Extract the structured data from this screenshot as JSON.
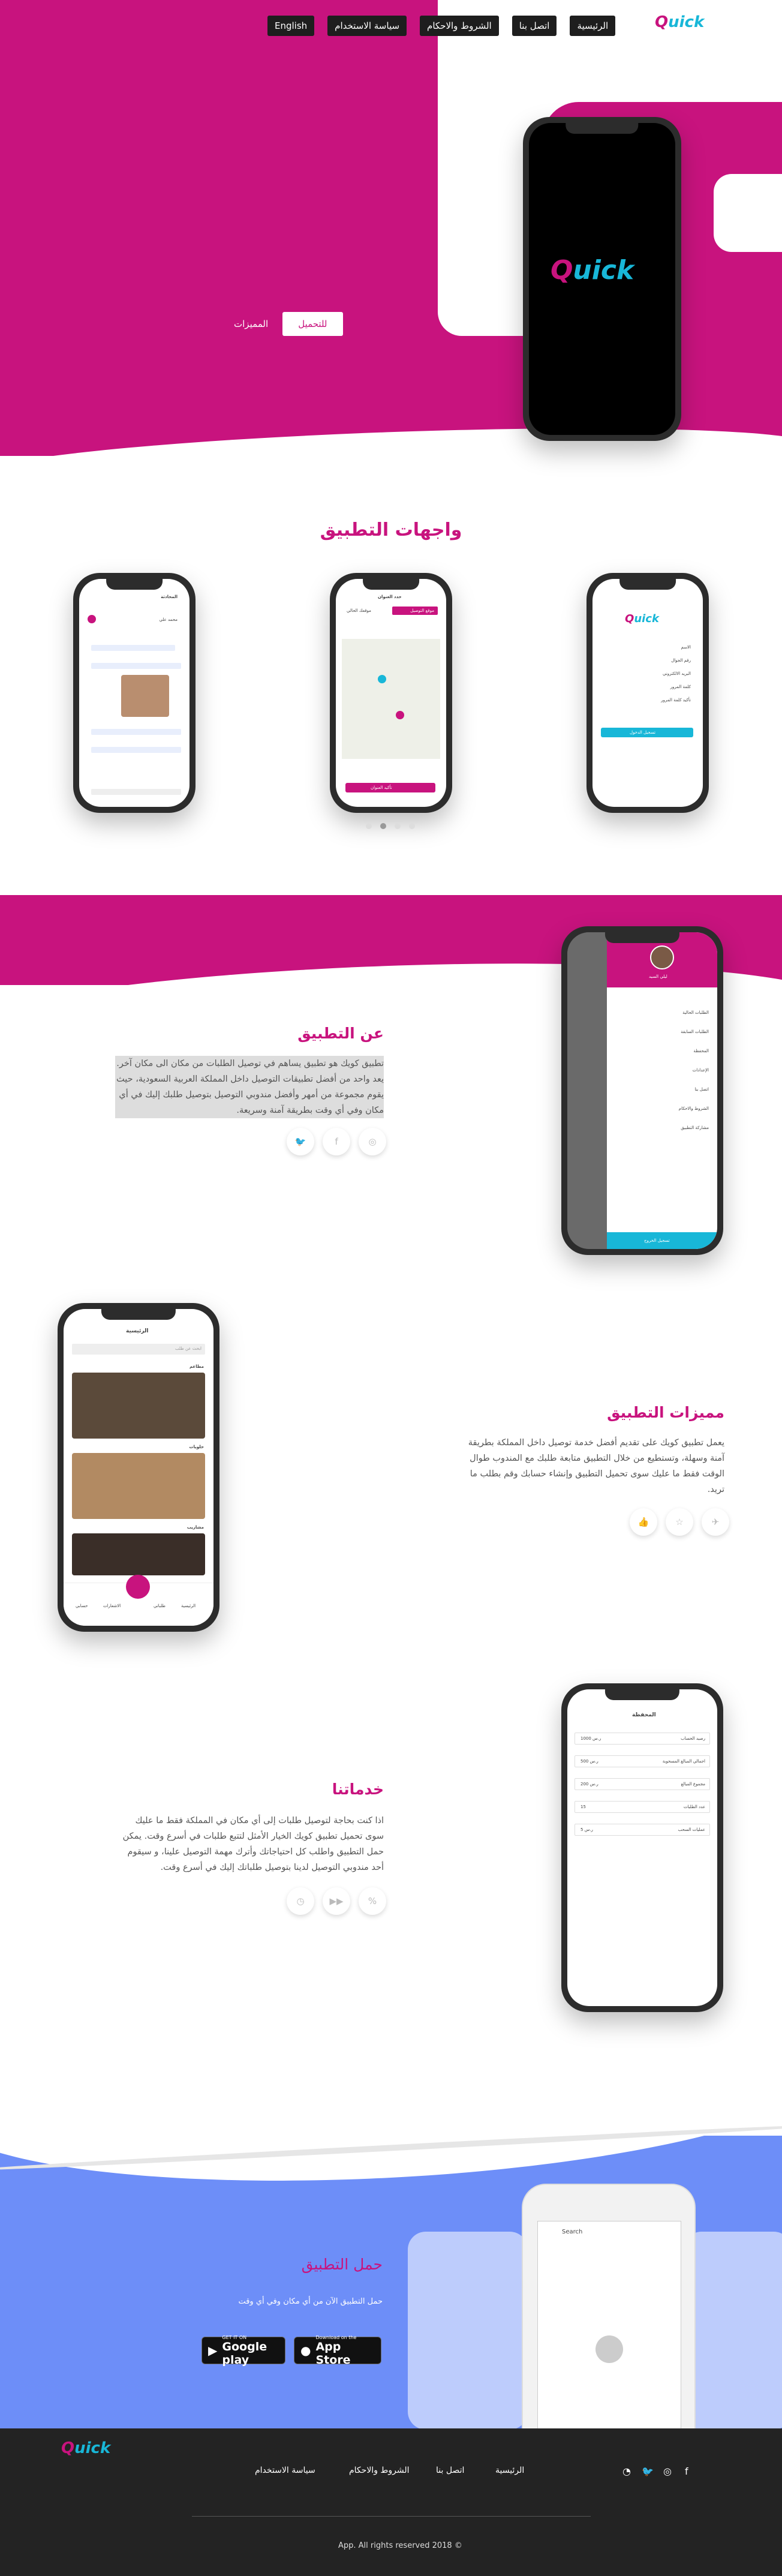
{
  "brand": {
    "logo_q": "Q",
    "logo_rest": "uick",
    "accent": "#c8137e",
    "secondary": "#18b7d8",
    "blue": "#6d8ef8"
  },
  "nav": {
    "english": "English",
    "privacy": "سياسة الاستخدام",
    "terms": "الشروط والاحكام",
    "contact": "اتصل بنا",
    "home": "الرئيسية"
  },
  "hero": {
    "download": "للتحميل",
    "features": "المميزات"
  },
  "screens_section": {
    "title": "واجهات التطبيق",
    "dots": 4,
    "active_dot": 2
  },
  "about": {
    "title": "عن التطبيق",
    "text": "تطبيق كويك هو تطبيق يساهم في توصيل الطلبات من مكان الى مكان آخر. يعد واحد من أفضل تطبيقات التوصيل داخل المملكة العربية السعودية، حيث يقوم مجموعة من أمهر وأفضل مندوبي التوصيل بتوصيل طلبك إليك في أي مكان وفي أي وقت بطريقة آمنة وسريعة.",
    "icons": [
      "twitter-icon",
      "facebook-icon",
      "instagram-icon"
    ]
  },
  "features": {
    "title": "مميزات التطبيق",
    "text": "يعمل تطبيق كويك على تقديم أفضل خدمة توصيل داخل المملكة بطريقة آمنة وسهلة، وتستطيع من خلال التطبيق متابعة طلبك مع المندوب طوال الوقت فقط ما عليك سوى تحميل التطبيق وإنشاء حسابك وقم بطلب ما تريد."
  },
  "services": {
    "title": "خدماتنا",
    "text": "اذا كنت بحاجة لتوصيل طلبات إلى أي مكان في المملكة فقط ما عليك سوى تحميل تطبيق كويك الخيار الأمثل لتتبع طلبات في أسرع وقت. يمكن حمل التطبيق واطلب كل احتياجاتك وأترك مهمة التوصيل علينا، و سيقوم أحد مندوبي التوصيل لدينا بتوصيل طلباتك إليك في أسرع وقت."
  },
  "download": {
    "title": "حمل التطبيق",
    "subtitle": "حمل التطبيق الآن من أي مكان وفي أي وقت",
    "google_small": "GET IT ON",
    "google_big": "Google play",
    "apple_small": "Download on the",
    "apple_big": "App Store",
    "search_placeholder": "Search"
  },
  "footer": {
    "home": "الرئيسية",
    "contact": "اتصل بنا",
    "terms": "الشروط والاحكام",
    "privacy": "سياسة الاستخدام",
    "copyright": "App. All rights reserved 2018 ©"
  },
  "phone_menu": {
    "user": "ليلي السيد",
    "items": [
      "الطلبات الحالية",
      "الطلبات السابقة",
      "المحفظة",
      "الإعدادات",
      "اتصل بنا",
      "الشروط والاحكام",
      "مشاركة التطبيق"
    ],
    "cta": "تسجيل الخروج"
  },
  "phone_home": {
    "title": "الرئيسية",
    "search": "ابحث عن طلب",
    "sec1": "مطاعم",
    "sec2": "حلويات",
    "sec3": "مشاريب",
    "tabs": [
      "الرئيسية",
      "طلباتي",
      "الاشعارات",
      "حسابي"
    ]
  },
  "phone_wallet": {
    "title": "المحفظة",
    "rows": [
      {
        "label": "رصيد الحساب",
        "value": "1000 ر.س"
      },
      {
        "label": "اجمالي المبالغ المسحوبة",
        "value": "500 ر.س"
      },
      {
        "label": "مجموع المبالغ",
        "value": "200 ر.س"
      },
      {
        "label": "عدد الطلبات",
        "value": "15"
      },
      {
        "label": "عمليات السحب",
        "value": "5 ر.س"
      }
    ]
  },
  "phone_chat": {
    "title": "المحادثة",
    "name": "محمد علي"
  },
  "phone_map": {
    "title": "حدد العنوان",
    "tab1": "موقعك الحالي",
    "tab2": "موقع التوصيل",
    "btn": "تأكيد العنوان"
  },
  "phone_login": {
    "title": "تسجيل الدخول",
    "btn": "تسجيل الدخول",
    "fields": [
      "الاسم",
      "رقم الجوال",
      "البريد الالكتروني",
      "كلمة المرور",
      "تأكيد كلمة المرور"
    ]
  }
}
